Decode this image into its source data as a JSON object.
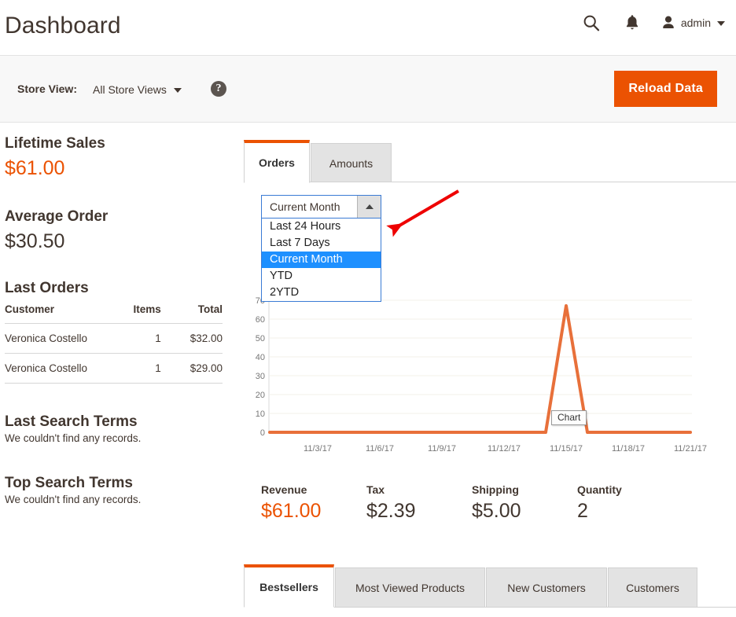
{
  "header": {
    "title": "Dashboard",
    "search_icon": "search-icon",
    "notifications_icon": "bell-icon",
    "user_icon": "user-avatar-icon",
    "admin_label": "admin",
    "caret_icon": "chevron-down-icon"
  },
  "storeview": {
    "label": "Store View:",
    "value": "All Store Views",
    "caret_icon": "chevron-down-icon",
    "help_icon": "question-mark-icon",
    "help_glyph": "?",
    "reload_label": "Reload Data"
  },
  "sidebar": {
    "lifetime_sales": {
      "title": "Lifetime Sales",
      "value": "$61.00"
    },
    "average_order": {
      "title": "Average Order",
      "value": "$30.50"
    },
    "last_orders": {
      "title": "Last Orders",
      "columns": [
        "Customer",
        "Items",
        "Total"
      ],
      "rows": [
        {
          "customer": "Veronica Costello",
          "items": "1",
          "total": "$32.00"
        },
        {
          "customer": "Veronica Costello",
          "items": "1",
          "total": "$29.00"
        }
      ]
    },
    "last_search_terms": {
      "title": "Last Search Terms",
      "empty": "We couldn't find any records."
    },
    "top_search_terms": {
      "title": "Top Search Terms",
      "empty": "We couldn't find any records."
    }
  },
  "main": {
    "tabs": [
      {
        "label": "Orders",
        "active": true
      },
      {
        "label": "Amounts",
        "active": false
      }
    ],
    "period_select": {
      "selected": "Current Month",
      "arrow_icon": "chevron-up-icon",
      "expanded": true,
      "options": [
        {
          "label": "Last 24 Hours",
          "selected": false
        },
        {
          "label": "Last 7 Days",
          "selected": false
        },
        {
          "label": "Current Month",
          "selected": true
        },
        {
          "label": "YTD",
          "selected": false
        },
        {
          "label": "2YTD",
          "selected": false
        }
      ]
    },
    "chart_tooltip": "Chart",
    "kpis": [
      {
        "label": "Revenue",
        "value": "$61.00",
        "accent": true
      },
      {
        "label": "Tax",
        "value": "$2.39",
        "accent": false
      },
      {
        "label": "Shipping",
        "value": "$5.00",
        "accent": false
      },
      {
        "label": "Quantity",
        "value": "2",
        "accent": false
      }
    ],
    "bottom_tabs": [
      {
        "label": "Bestsellers",
        "active": true
      },
      {
        "label": "Most Viewed Products",
        "active": false
      },
      {
        "label": "New Customers",
        "active": false
      },
      {
        "label": "Customers",
        "active": false
      }
    ]
  },
  "colors": {
    "accent_orange": "#eb5202",
    "chart_line": "#e8703a",
    "select_border": "#3a7bd5",
    "option_highlight": "#1e90ff",
    "annotation_red": "#ee0000",
    "text_dark": "#41362f"
  },
  "annotation": {
    "type": "arrow",
    "color": "#ee0000",
    "from": [
      583,
      243
    ],
    "to": [
      497,
      293
    ]
  },
  "chart_data": {
    "type": "line",
    "title": "",
    "xlabel": "",
    "ylabel": "",
    "ylim": [
      0,
      70
    ],
    "yticks": [
      0,
      10,
      20,
      30,
      40,
      50,
      60,
      70
    ],
    "grid": true,
    "legend": "none",
    "x_tick_labels": [
      "11/3/17",
      "11/6/17",
      "11/9/17",
      "11/12/17",
      "11/15/17",
      "11/18/17",
      "11/21/17"
    ],
    "x": [
      "11/1/17",
      "11/2/17",
      "11/3/17",
      "11/4/17",
      "11/5/17",
      "11/6/17",
      "11/7/17",
      "11/8/17",
      "11/9/17",
      "11/10/17",
      "11/11/17",
      "11/12/17",
      "11/13/17",
      "11/14/17",
      "11/15/17",
      "11/16/17",
      "11/17/17",
      "11/18/17",
      "11/19/17",
      "11/20/17",
      "11/21/17",
      "11/22/17"
    ],
    "series": [
      {
        "name": "Orders",
        "color": "#e8703a",
        "values": [
          0,
          0,
          0,
          0,
          0,
          0,
          0,
          0,
          0,
          0,
          0,
          0,
          0,
          0,
          67,
          0,
          0,
          0,
          0,
          0,
          0,
          0
        ]
      }
    ]
  }
}
